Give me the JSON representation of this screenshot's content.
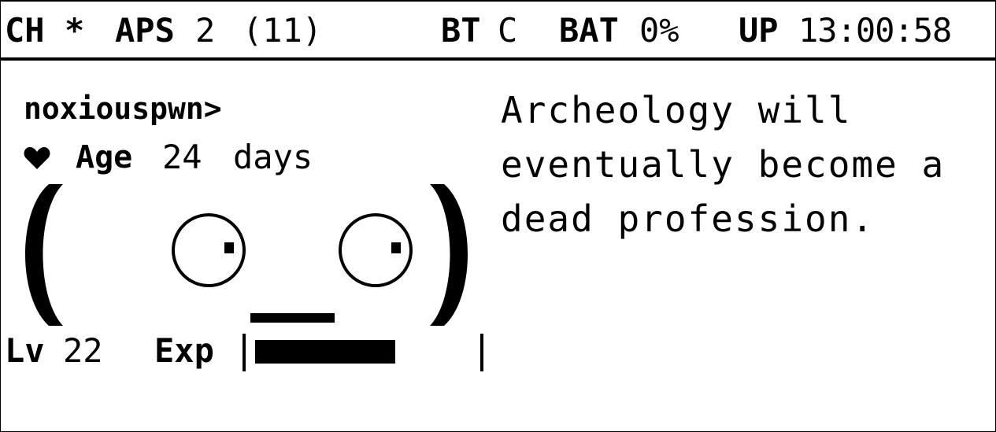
{
  "status": {
    "ch_label": "CH",
    "ch_value": "*",
    "aps_label": "APS",
    "aps_value": "2",
    "aps_count": "(11)",
    "bt_label": "BT",
    "bt_value": "C",
    "bat_label": "BAT",
    "bat_value": "0%",
    "up_label": "UP",
    "up_value": "13:00:58"
  },
  "pet": {
    "name": "noxiouspwn>",
    "age_label": "Age",
    "age_value": "24",
    "age_unit": "days",
    "level_label": "Lv",
    "level_value": "22",
    "exp_label": "Exp",
    "exp_fraction": 0.66
  },
  "message": {
    "text": "Archeology will\neventually become a\ndead profession."
  },
  "icons": {
    "heart": "heart-icon",
    "face": "pet-face"
  },
  "colors": {
    "foreground": "#000000",
    "background": "#ffffff"
  }
}
